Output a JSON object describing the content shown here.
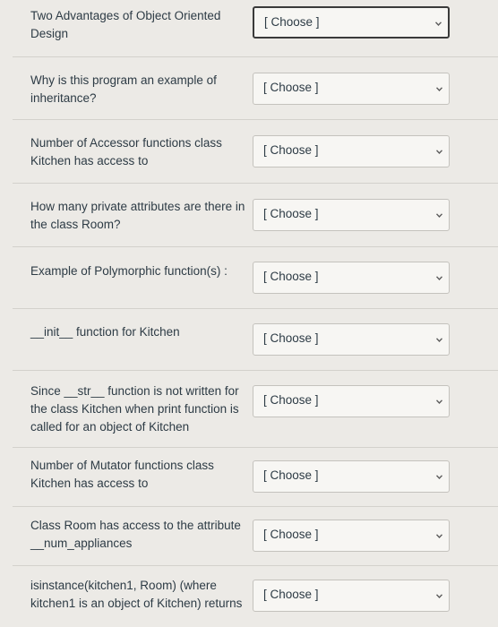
{
  "questions": [
    {
      "text": "Two Advantages of Object Oriented Design",
      "selected": "[ Choose ]"
    },
    {
      "text": "Why is this program an example of inheritance?",
      "selected": "[ Choose ]"
    },
    {
      "text": "Number of Accessor functions class Kitchen has access to",
      "selected": "[ Choose ]"
    },
    {
      "text": "How many private attributes are there in the class Room?",
      "selected": "[ Choose ]"
    },
    {
      "text": "Example of Polymorphic function(s) :",
      "selected": "[ Choose ]"
    },
    {
      "text": "__init__ function for Kitchen",
      "selected": "[ Choose ]"
    },
    {
      "text": "Since __str__ function is not written for the class Kitchen when print function is called for an object of Kitchen",
      "selected": "[ Choose ]"
    },
    {
      "text": "Number of Mutator functions class Kitchen has access to",
      "selected": "[ Choose ]"
    },
    {
      "text": "Class Room has access to the attribute __num_appliances",
      "selected": "[ Choose ]"
    },
    {
      "text": "isinstance(kitchen1, Room) (where kitchen1 is an object of Kitchen) returns",
      "selected": "[ Choose ]"
    }
  ],
  "icons": {
    "dropdown": "chevron-down-icon"
  }
}
